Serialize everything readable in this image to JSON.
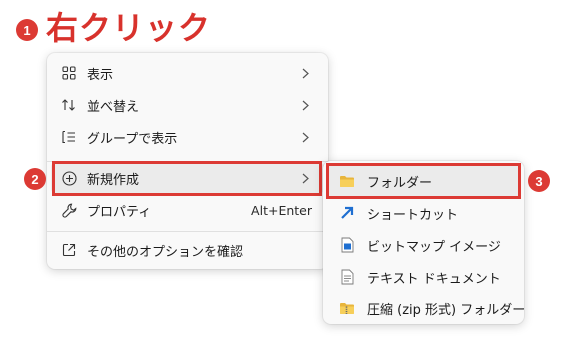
{
  "heading": {
    "badge": "1",
    "text": "右クリック"
  },
  "main_menu": {
    "items": [
      {
        "label": "表示",
        "icon": "grid-icon",
        "has_submenu": true
      },
      {
        "label": "並べ替え",
        "icon": "sort-icon",
        "has_submenu": true
      },
      {
        "label": "グループで表示",
        "icon": "group-list-icon",
        "has_submenu": true
      },
      {
        "label": "新規作成",
        "icon": "plus-circle-icon",
        "has_submenu": true,
        "badge": "2",
        "highlighted": true
      },
      {
        "label": "プロパティ",
        "icon": "wrench-icon",
        "shortcut": "Alt+Enter"
      },
      {
        "label": "その他のオプションを確認",
        "icon": "open-external-icon"
      }
    ]
  },
  "sub_menu": {
    "badge": "3",
    "items": [
      {
        "label": "フォルダー",
        "icon": "folder-icon",
        "highlighted": true
      },
      {
        "label": "ショートカット",
        "icon": "shortcut-arrow-icon"
      },
      {
        "label": "ビットマップ イメージ",
        "icon": "bitmap-file-icon"
      },
      {
        "label": "テキスト ドキュメント",
        "icon": "text-file-icon"
      },
      {
        "label": "圧縮 (zip 形式) フォルダー",
        "icon": "zip-folder-icon"
      }
    ]
  },
  "colors": {
    "accent_red": "#dc3a34",
    "heading_red": "#d8322c"
  }
}
